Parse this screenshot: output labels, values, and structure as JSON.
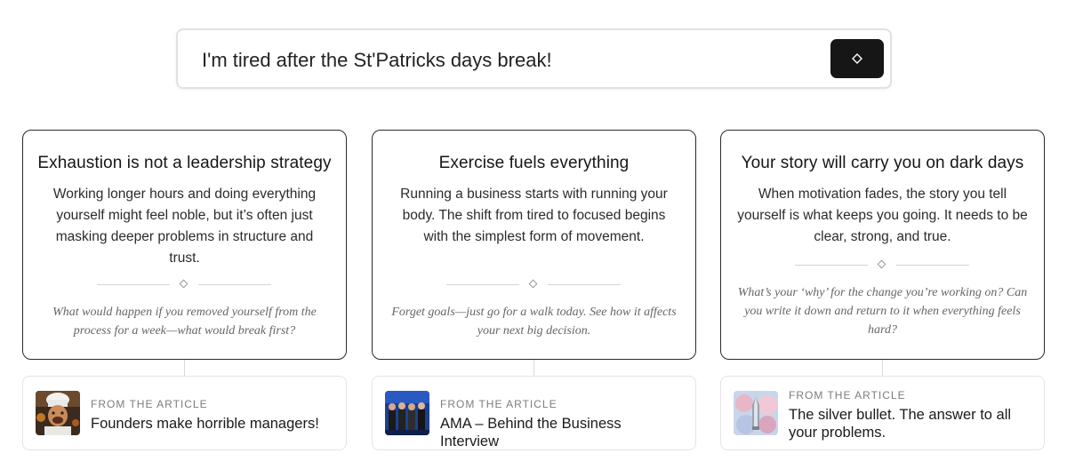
{
  "search": {
    "value": "I'm tired after the St'Patricks days break!",
    "submit_icon": "diamond-icon"
  },
  "cards": [
    {
      "title": "Exhaustion is not a leadership strategy",
      "body": "Working longer hours and doing everything yourself might feel noble, but it’s often just masking deeper problems in structure and trust.",
      "prompt": "What would happen if you removed yourself from the process for a week—what would break first?",
      "article": {
        "kicker": "FROM THE ARTICLE",
        "title": "Founders make horrible managers!",
        "thumb_icon": "chef-photo"
      }
    },
    {
      "title": "Exercise fuels everything",
      "body": "Running a business starts with running your body. The shift from tired to focused begins with the simplest form of movement.",
      "prompt": "Forget goals—just go for a walk today. See how it affects your next big decision.",
      "article": {
        "kicker": "FROM THE ARTICLE",
        "title": "AMA – Behind the Business Interview",
        "thumb_icon": "group-photo"
      }
    },
    {
      "title": "Your story will carry you on dark days",
      "body": "When motivation fades, the story you tell yourself is what keeps you going. It needs to be clear, strong, and true.",
      "prompt": "What’s your ‘why’ for the change you’re working on? Can you write it down and return to it when everything feels hard?",
      "article": {
        "kicker": "FROM THE ARTICLE",
        "title": "The silver bullet. The answer to all your problems.",
        "thumb_icon": "silver-bullet-illustration"
      }
    }
  ]
}
